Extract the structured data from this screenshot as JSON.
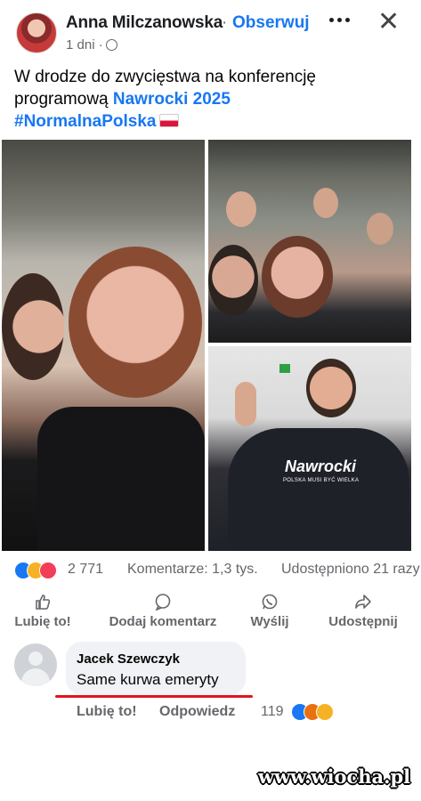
{
  "post": {
    "author": "Anna Milczanowska",
    "separator": "·",
    "follow_label": "Obserwuj",
    "time": "1 dni",
    "time_sep": "·",
    "text_line1": "W drodze do zwycięstwa na konferencję",
    "text_line2_prefix": "programową ",
    "text_line2_link": "Nawrocki 2025",
    "hashtag": "#NormalnaPolska"
  },
  "photo_shirt": {
    "brand": "Nawrocki",
    "slogan": "POLSKA MUSI BYĆ WIELKA"
  },
  "stats": {
    "reactions_count": "2 771",
    "comments": "Komentarze: 1,3 tys.",
    "shares": "Udostępniono 21 razy",
    "reaction_icons": [
      "like-icon",
      "haha-icon",
      "love-icon"
    ]
  },
  "actions": {
    "like": "Lubię to!",
    "comment": "Dodaj komentarz",
    "send": "Wyślij",
    "share": "Udostępnij"
  },
  "comment": {
    "author": "Jacek Szewczyk",
    "text": "Same kurwa emeryty",
    "like": "Lubię to!",
    "reply": "Odpowiedz",
    "reactions_count": "119",
    "reaction_icons": [
      "like-icon",
      "angry-icon",
      "haha-icon"
    ],
    "underline_color": "#e0141e"
  },
  "watermark": "www.wiocha.pl",
  "colors": {
    "accent": "#1877f2",
    "muted_text": "#65676b",
    "bubble": "#f0f2f5"
  }
}
